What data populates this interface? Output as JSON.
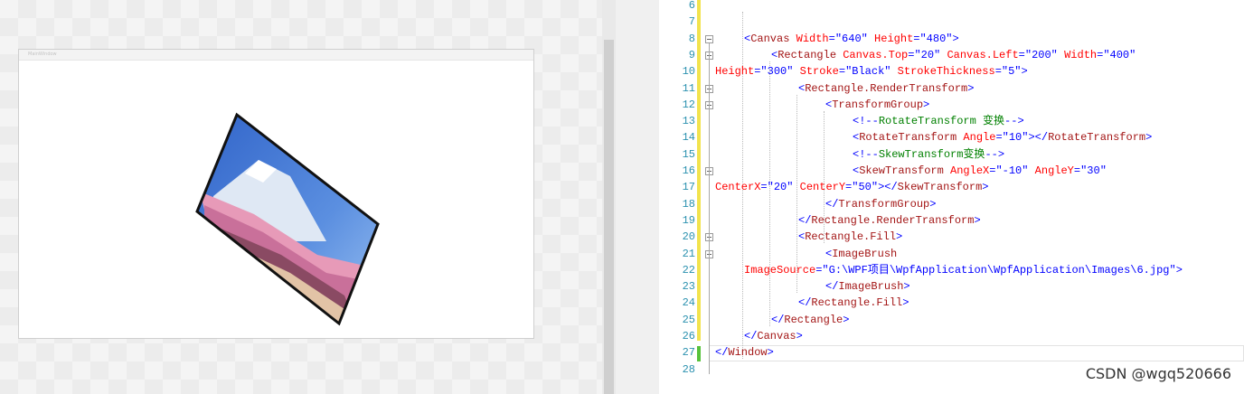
{
  "designer": {
    "window_title": "MainWindow"
  },
  "editor": {
    "lines": [
      {
        "num": "6",
        "parts": []
      },
      {
        "num": "7",
        "parts": []
      },
      {
        "num": "8",
        "parts": [
          {
            "t": "br",
            "s": "<"
          },
          {
            "t": "el",
            "s": "Canvas"
          },
          {
            "t": "attr",
            "s": " Width"
          },
          {
            "t": "br",
            "s": "="
          },
          {
            "t": "val",
            "s": "\"640\""
          },
          {
            "t": "attr",
            "s": " Height"
          },
          {
            "t": "br",
            "s": "="
          },
          {
            "t": "val",
            "s": "\"480\""
          },
          {
            "t": "br",
            "s": ">"
          }
        ]
      },
      {
        "num": "9",
        "parts": [
          {
            "t": "br",
            "s": "<"
          },
          {
            "t": "el",
            "s": "Rectangle"
          },
          {
            "t": "attr",
            "s": " Canvas.Top"
          },
          {
            "t": "br",
            "s": "="
          },
          {
            "t": "val",
            "s": "\"20\""
          },
          {
            "t": "attr",
            "s": " Canvas.Left"
          },
          {
            "t": "br",
            "s": "="
          },
          {
            "t": "val",
            "s": "\"200\""
          },
          {
            "t": "attr",
            "s": " Width"
          },
          {
            "t": "br",
            "s": "="
          },
          {
            "t": "val",
            "s": "\"400\""
          }
        ]
      },
      {
        "num": "10",
        "parts": [
          {
            "t": "attr",
            "s": "Height"
          },
          {
            "t": "br",
            "s": "="
          },
          {
            "t": "val",
            "s": "\"300\""
          },
          {
            "t": "attr",
            "s": " Stroke"
          },
          {
            "t": "br",
            "s": "="
          },
          {
            "t": "val",
            "s": "\"Black\""
          },
          {
            "t": "attr",
            "s": " StrokeThickness"
          },
          {
            "t": "br",
            "s": "="
          },
          {
            "t": "val",
            "s": "\"5\""
          },
          {
            "t": "br",
            "s": ">"
          }
        ]
      },
      {
        "num": "11",
        "parts": [
          {
            "t": "br",
            "s": "<"
          },
          {
            "t": "el",
            "s": "Rectangle.RenderTransform"
          },
          {
            "t": "br",
            "s": ">"
          }
        ]
      },
      {
        "num": "12",
        "parts": [
          {
            "t": "br",
            "s": "<"
          },
          {
            "t": "el",
            "s": "TransformGroup"
          },
          {
            "t": "br",
            "s": ">"
          }
        ]
      },
      {
        "num": "13",
        "parts": [
          {
            "t": "br",
            "s": "<!--"
          },
          {
            "t": "cm",
            "s": "RotateTransform 变换"
          },
          {
            "t": "br",
            "s": "-->"
          }
        ]
      },
      {
        "num": "14",
        "parts": [
          {
            "t": "br",
            "s": "<"
          },
          {
            "t": "el",
            "s": "RotateTransform"
          },
          {
            "t": "attr",
            "s": " Angle"
          },
          {
            "t": "br",
            "s": "="
          },
          {
            "t": "val",
            "s": "\"10\""
          },
          {
            "t": "br",
            "s": "></"
          },
          {
            "t": "el",
            "s": "RotateTransform"
          },
          {
            "t": "br",
            "s": ">"
          }
        ]
      },
      {
        "num": "15",
        "parts": [
          {
            "t": "br",
            "s": "<!--"
          },
          {
            "t": "cm",
            "s": "SkewTransform变换"
          },
          {
            "t": "br",
            "s": "-->"
          }
        ]
      },
      {
        "num": "16",
        "parts": [
          {
            "t": "br",
            "s": "<"
          },
          {
            "t": "el",
            "s": "SkewTransform"
          },
          {
            "t": "attr",
            "s": " AngleX"
          },
          {
            "t": "br",
            "s": "="
          },
          {
            "t": "val",
            "s": "\"-10\""
          },
          {
            "t": "attr",
            "s": " AngleY"
          },
          {
            "t": "br",
            "s": "="
          },
          {
            "t": "val",
            "s": "\"30\""
          }
        ]
      },
      {
        "num": "17",
        "parts": [
          {
            "t": "attr",
            "s": "CenterX"
          },
          {
            "t": "br",
            "s": "="
          },
          {
            "t": "val",
            "s": "\"20\""
          },
          {
            "t": "attr",
            "s": " CenterY"
          },
          {
            "t": "br",
            "s": "="
          },
          {
            "t": "val",
            "s": "\"50\""
          },
          {
            "t": "br",
            "s": "></"
          },
          {
            "t": "el",
            "s": "SkewTransform"
          },
          {
            "t": "br",
            "s": ">"
          }
        ]
      },
      {
        "num": "18",
        "parts": [
          {
            "t": "br",
            "s": "</"
          },
          {
            "t": "el",
            "s": "TransformGroup"
          },
          {
            "t": "br",
            "s": ">"
          }
        ]
      },
      {
        "num": "19",
        "parts": [
          {
            "t": "br",
            "s": "</"
          },
          {
            "t": "el",
            "s": "Rectangle.RenderTransform"
          },
          {
            "t": "br",
            "s": ">"
          }
        ]
      },
      {
        "num": "20",
        "parts": [
          {
            "t": "br",
            "s": "<"
          },
          {
            "t": "el",
            "s": "Rectangle.Fill"
          },
          {
            "t": "br",
            "s": ">"
          }
        ]
      },
      {
        "num": "21",
        "parts": [
          {
            "t": "br",
            "s": "<"
          },
          {
            "t": "el",
            "s": "ImageBrush"
          }
        ]
      },
      {
        "num": "22",
        "parts": [
          {
            "t": "attr",
            "s": "ImageSource"
          },
          {
            "t": "br",
            "s": "="
          },
          {
            "t": "val",
            "s": "\"G:\\WPF项目\\WpfApplication\\WpfApplication\\Images\\6.jpg\""
          },
          {
            "t": "br",
            "s": ">"
          }
        ]
      },
      {
        "num": "23",
        "parts": [
          {
            "t": "br",
            "s": "</"
          },
          {
            "t": "el",
            "s": "ImageBrush"
          },
          {
            "t": "br",
            "s": ">"
          }
        ]
      },
      {
        "num": "24",
        "parts": [
          {
            "t": "br",
            "s": "</"
          },
          {
            "t": "el",
            "s": "Rectangle.Fill"
          },
          {
            "t": "br",
            "s": ">"
          }
        ]
      },
      {
        "num": "25",
        "parts": [
          {
            "t": "br",
            "s": "</"
          },
          {
            "t": "el",
            "s": "Rectangle"
          },
          {
            "t": "br",
            "s": ">"
          }
        ]
      },
      {
        "num": "26",
        "parts": [
          {
            "t": "br",
            "s": "</"
          },
          {
            "t": "el",
            "s": "Canvas"
          },
          {
            "t": "br",
            "s": ">"
          }
        ]
      },
      {
        "num": "27",
        "parts": [
          {
            "t": "br",
            "s": "</"
          },
          {
            "t": "el",
            "s": "Window"
          },
          {
            "t": "br",
            "s": ">"
          }
        ]
      },
      {
        "num": "28",
        "parts": []
      }
    ]
  },
  "watermark": "CSDN @wgq520666",
  "colors": {
    "line_number": "#2b91af",
    "element": "#a31515",
    "attribute": "#ff0000",
    "value": "#0000ff",
    "comment": "#008000",
    "modified_bar": "#f2e34d",
    "saved_bar": "#57c23a"
  }
}
